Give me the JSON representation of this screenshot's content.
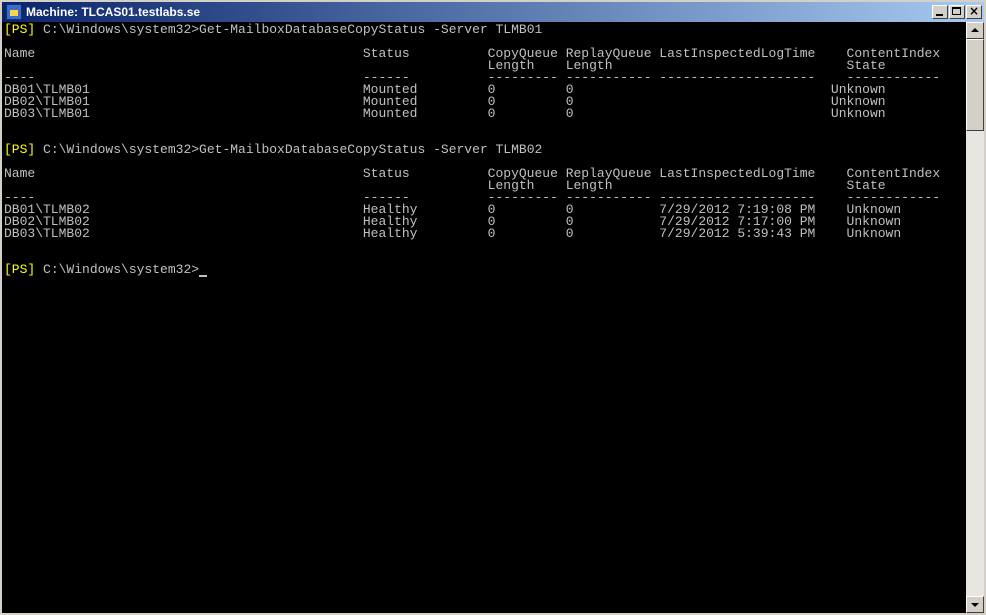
{
  "window": {
    "title": "Machine: TLCAS01.testlabs.se",
    "controls": {
      "minimize": "minimize-button",
      "maximize": "maximize-button",
      "close": "close-button"
    },
    "icon": "powershell-icon"
  },
  "console": {
    "prompt_tag": "[PS]",
    "prompt_path": " C:\\Windows\\system32>",
    "command1": "Get-MailboxDatabaseCopyStatus -Server TLMB01",
    "command2": "Get-MailboxDatabaseCopyStatus -Server TLMB02",
    "header_line1": "Name                                          Status          CopyQueue ReplayQueue LastInspectedLogTime    ContentIndex",
    "header_line2": "                                                              Length    Length                              State",
    "separator": "----                                          ------          --------- ----------- --------------------    ------------",
    "table1": [
      "DB01\\TLMB01                                   Mounted         0         0                                 Unknown",
      "DB02\\TLMB01                                   Mounted         0         0                                 Unknown",
      "DB03\\TLMB01                                   Mounted         0         0                                 Unknown"
    ],
    "table2": [
      "DB01\\TLMB02                                   Healthy         0         0           7/29/2012 7:19:08 PM    Unknown",
      "DB02\\TLMB02                                   Healthy         0         0           7/29/2012 7:17:00 PM    Unknown",
      "DB03\\TLMB02                                   Healthy         0         0           7/29/2012 5:39:43 PM    Unknown"
    ]
  },
  "colors": {
    "background": "#000000",
    "text": "#c0c0c0",
    "prompt_tag": "#ffff00",
    "titlebar_start": "#0a246a",
    "titlebar_end": "#a6caf0"
  }
}
